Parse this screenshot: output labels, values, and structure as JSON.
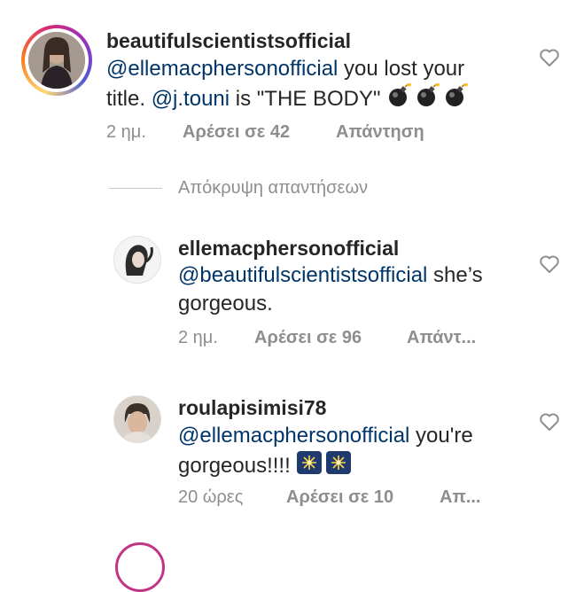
{
  "comments": [
    {
      "username": "beautifulscientistsofficial",
      "mention1": "@ellemacphersonofficial",
      "text1": " you lost your",
      "text2a": "title. ",
      "mention2": "@j.touni",
      "text2b": "  is \"THE BODY\" ",
      "time": "2 ημ.",
      "likes": "Αρέσει σε 42",
      "reply": "Απάντηση",
      "emoji": "bomb"
    },
    {
      "username": "ellemacphersonofficial",
      "mention1": "@beautifulscientistsofficial",
      "text1": " she’s",
      "text2": "gorgeous.",
      "time": "2 ημ.",
      "likes": "Αρέσει σε 96",
      "reply": "Απάντ..."
    },
    {
      "username": "roulapisimisi78",
      "mention1": "@ellemacphersonofficial",
      "text1": " you're",
      "text2": "gorgeous!!!! ",
      "time": "20 ώρες",
      "likes": "Αρέσει σε 10",
      "reply": "Απ...",
      "emoji": "sparkler"
    }
  ],
  "hide_replies": "Απόκρυψη απαντήσεων",
  "colors": {
    "mention": "#003569",
    "meta": "#8e8e8e",
    "text": "#262626"
  },
  "icons": [
    "heart-outline-icon",
    "bomb-icon",
    "sparkler-icon"
  ]
}
